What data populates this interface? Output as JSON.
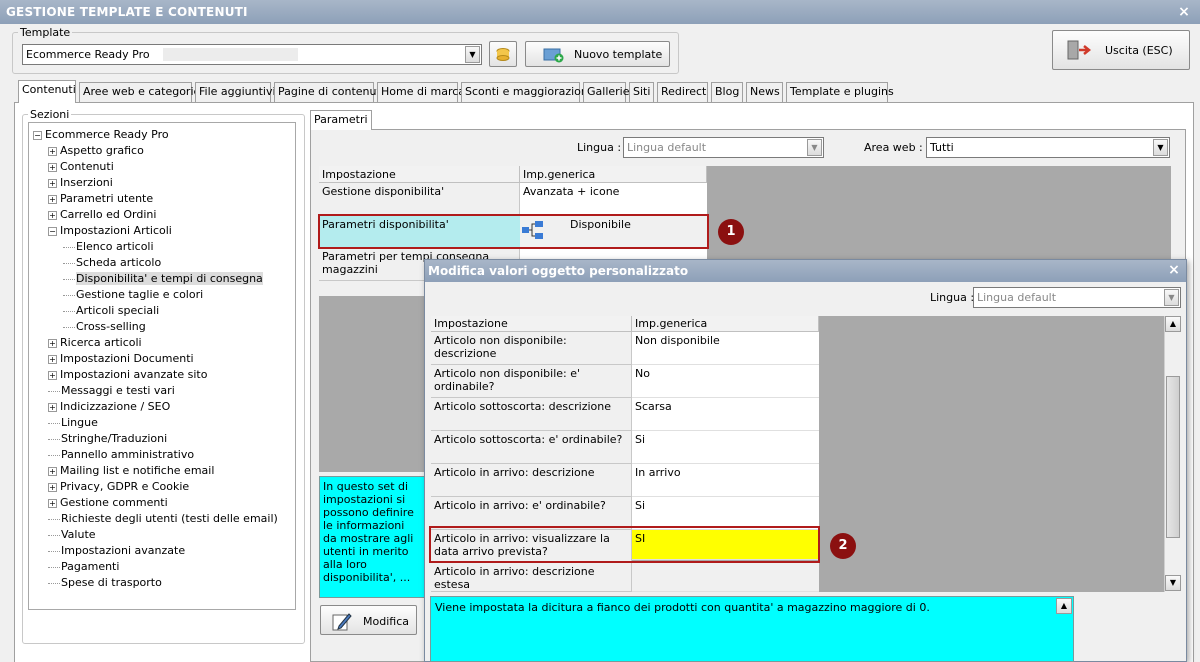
{
  "window": {
    "title": "GESTIONE TEMPLATE E CONTENUTI",
    "close": "×"
  },
  "template": {
    "group_label": "Template",
    "value": "Ecommerce Ready Pro",
    "new_button": "Nuovo template"
  },
  "exit_button": "Uscita (ESC)",
  "tabs": [
    "Contenuti",
    "Aree web e categorie",
    "File aggiuntivi",
    "Pagine di contenuti",
    "Home di marca",
    "Sconti e maggiorazioni",
    "Gallerie",
    "Siti",
    "Redirect",
    "Blog",
    "News",
    "Template e plugins"
  ],
  "sections": {
    "label": "Sezioni",
    "tree": [
      {
        "label": "Ecommerce Ready Pro",
        "exp": "⊟"
      },
      {
        "label": "Aspetto grafico",
        "exp": "+"
      },
      {
        "label": "Contenuti",
        "exp": "+"
      },
      {
        "label": "Inserzioni",
        "exp": "+"
      },
      {
        "label": "Parametri utente",
        "exp": "+"
      },
      {
        "label": "Carrello ed Ordini",
        "exp": "+"
      },
      {
        "label": "Impostazioni Articoli",
        "exp": "−"
      },
      {
        "label": "Elenco articoli",
        "exp": ""
      },
      {
        "label": "Scheda articolo",
        "exp": ""
      },
      {
        "label": "Disponibilita' e tempi di consegna",
        "exp": ""
      },
      {
        "label": "Gestione taglie e colori",
        "exp": ""
      },
      {
        "label": "Articoli speciali",
        "exp": ""
      },
      {
        "label": "Cross-selling",
        "exp": ""
      },
      {
        "label": "Ricerca articoli",
        "exp": "+"
      },
      {
        "label": "Impostazioni Documenti",
        "exp": "+"
      },
      {
        "label": "Impostazioni avanzate sito",
        "exp": "+"
      },
      {
        "label": "Messaggi e testi vari",
        "exp": ""
      },
      {
        "label": "Indicizzazione / SEO",
        "exp": "+"
      },
      {
        "label": "Lingue",
        "exp": ""
      },
      {
        "label": "Stringhe/Traduzioni",
        "exp": ""
      },
      {
        "label": "Pannello amministrativo",
        "exp": ""
      },
      {
        "label": "Mailing list e notifiche email",
        "exp": "+"
      },
      {
        "label": "Privacy, GDPR e Cookie",
        "exp": "+"
      },
      {
        "label": "Gestione commenti",
        "exp": "+"
      },
      {
        "label": "Richieste degli utenti (testi delle email)",
        "exp": ""
      },
      {
        "label": "Valute",
        "exp": ""
      },
      {
        "label": "Impostazioni avanzate",
        "exp": ""
      },
      {
        "label": "Pagamenti",
        "exp": ""
      },
      {
        "label": "Spese di trasporto",
        "exp": ""
      }
    ]
  },
  "params": {
    "tab": "Parametri",
    "lingua_label": "Lingua :",
    "lingua_value": "Lingua default",
    "area_label": "Area web :",
    "area_value": "Tutti",
    "col1": "Impostazione",
    "col2": "Imp.generica",
    "rows": [
      {
        "k": "Gestione disponibilita'",
        "v": "Avanzata + icone"
      },
      {
        "k": "Parametri disponibilita'",
        "v": "Disponibile"
      },
      {
        "k": "Parametri per tempi consegna magazzini",
        "v": ""
      }
    ],
    "description": "In questo set di impostazioni si possono definire le informazioni da mostrare agli utenti in merito alla loro disponibilita', ...",
    "edit_button": "Modifica"
  },
  "dialog": {
    "title": "Modifica valori oggetto personalizzato",
    "close": "×",
    "lingua_label": "Lingua :",
    "lingua_value": "Lingua default",
    "col1": "Impostazione",
    "col2": "Imp.generica",
    "rows": [
      {
        "k": "Articolo non disponibile: descrizione",
        "v": "Non disponibile"
      },
      {
        "k": "Articolo non disponibile: e' ordinabile?",
        "v": "No"
      },
      {
        "k": "Articolo sottoscorta: descrizione",
        "v": "Scarsa"
      },
      {
        "k": "Articolo sottoscorta: e' ordinabile?",
        "v": "Si"
      },
      {
        "k": "Articolo in arrivo: descrizione",
        "v": "In arrivo"
      },
      {
        "k": "Articolo in arrivo: e' ordinabile?",
        "v": "Si"
      },
      {
        "k": "Articolo in arrivo: visualizzare la data arrivo prevista?",
        "v": "SI"
      },
      {
        "k": "Articolo in arrivo: descrizione estesa",
        "v": ""
      }
    ],
    "description": "Viene impostata la dicitura a fianco dei prodotti con quantita' a magazzino maggiore di 0."
  },
  "badges": [
    "1",
    "2"
  ],
  "colors": {
    "highlight_cyan": "#00ffff",
    "selected_row": "#b4ecee",
    "yellow_cell": "#ffff00",
    "badge": "#8b1010",
    "red_box": "#b01b1b"
  }
}
